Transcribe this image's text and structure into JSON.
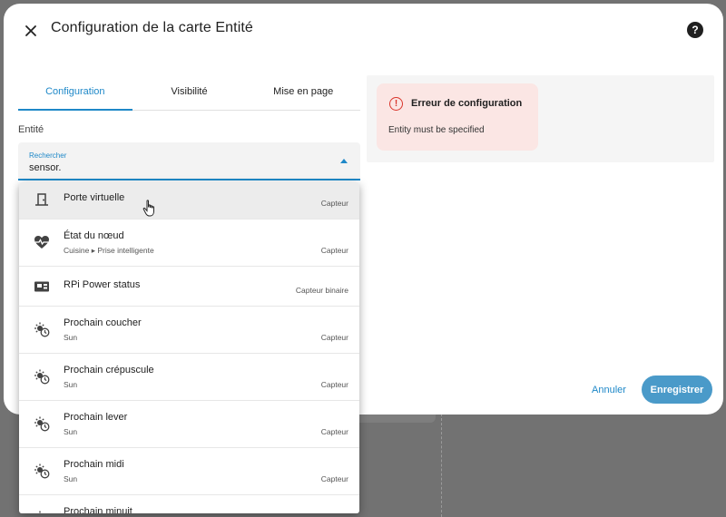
{
  "dialog": {
    "title": "Configuration de la carte Entité",
    "help_label": "?"
  },
  "tabs": [
    {
      "label": "Configuration",
      "active": true
    },
    {
      "label": "Visibilité",
      "active": false
    },
    {
      "label": "Mise en page",
      "active": false
    }
  ],
  "entity": {
    "label": "Entité",
    "search_label": "Rechercher",
    "search_value": "sensor."
  },
  "error": {
    "icon": "error-circle-icon",
    "title": "Erreur de configuration",
    "message": "Entity must be specified"
  },
  "actions": {
    "cancel": "Annuler",
    "save": "Enregistrer"
  },
  "options": [
    {
      "name": "Porte virtuelle",
      "sub": "",
      "domain": "Capteur",
      "icon": "door-icon",
      "hover": true
    },
    {
      "name": "État du nœud",
      "sub": "Cuisine ▸ Prise intelligente",
      "domain": "Capteur",
      "icon": "heart-pulse-icon",
      "hover": false
    },
    {
      "name": "RPi Power status",
      "sub": "",
      "domain": "Capteur binaire",
      "icon": "board-icon",
      "hover": false
    },
    {
      "name": "Prochain coucher",
      "sub": "Sun",
      "domain": "Capteur",
      "icon": "sun-clock-icon",
      "hover": false
    },
    {
      "name": "Prochain crépuscule",
      "sub": "Sun",
      "domain": "Capteur",
      "icon": "sun-clock-icon",
      "hover": false
    },
    {
      "name": "Prochain lever",
      "sub": "Sun",
      "domain": "Capteur",
      "icon": "sun-clock-icon",
      "hover": false
    },
    {
      "name": "Prochain midi",
      "sub": "Sun",
      "domain": "Capteur",
      "icon": "sun-clock-icon",
      "hover": false
    },
    {
      "name": "Prochain minuit",
      "sub": "",
      "domain": "",
      "icon": "sun-clock-icon",
      "hover": false
    }
  ],
  "colors": {
    "accent": "#1e88c8",
    "error": "#d9352b",
    "error_bg": "#fbe6e4",
    "save_bg": "#4a9ac9"
  }
}
